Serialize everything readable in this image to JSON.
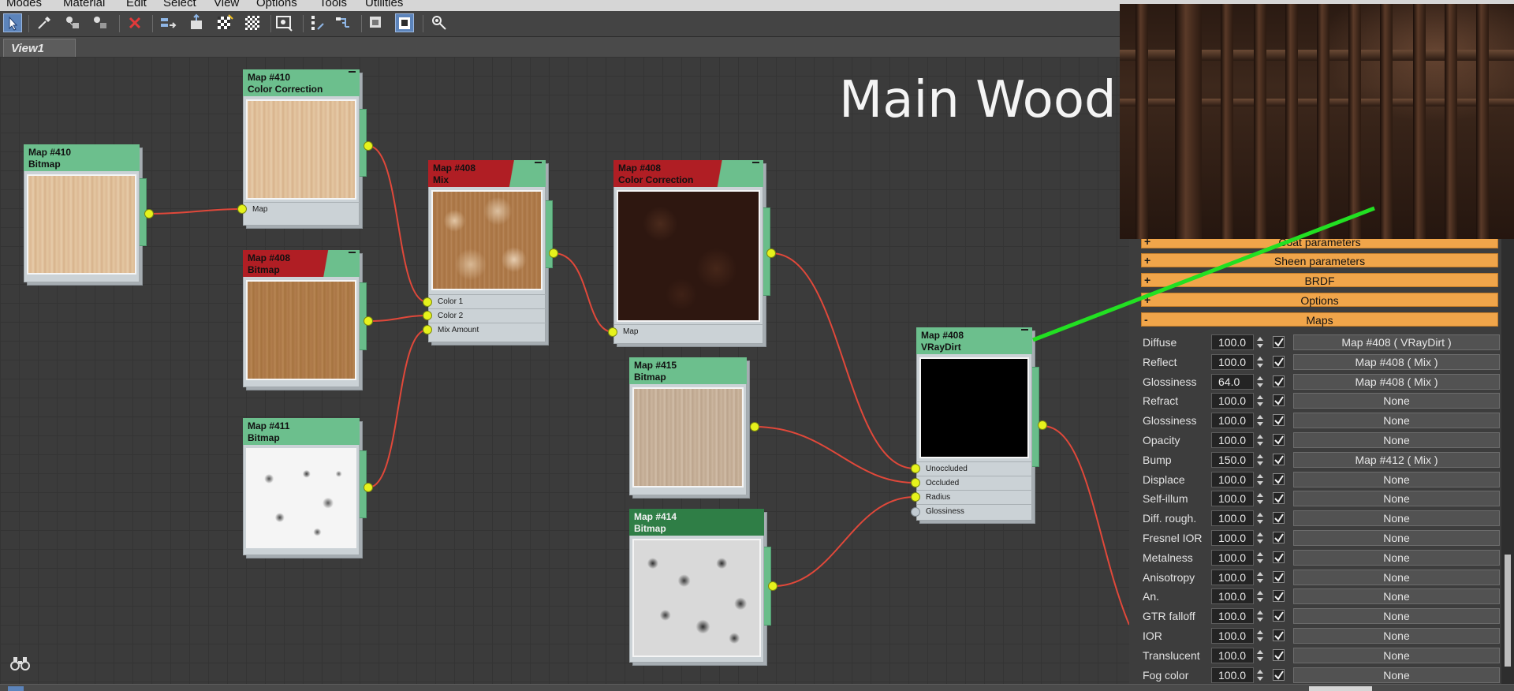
{
  "menu": [
    "Modes",
    "Material",
    "Edit",
    "Select",
    "View",
    "Options",
    "Tools",
    "Utilities"
  ],
  "toolbar": {
    "icons": [
      "select-arrow-icon",
      "eyedropper-icon",
      "put-to-scene-icon",
      "assign-to-selection-icon",
      "delete-icon",
      "move-children-icon",
      "hide-unused-icon",
      "show-map-in-viewport-icon",
      "checker-background-icon",
      "preview-icon",
      "layout-icon",
      "layout-children-icon",
      "show-end-result-icon",
      "parameter-editor-icon",
      "material-map-browser-icon"
    ]
  },
  "view_tab": "View1",
  "canvas": {
    "title": "Main Wood",
    "nodes": [
      {
        "id": "n1",
        "title": "Map #410",
        "subtitle": "Bitmap",
        "header": "green",
        "texture": "wood-light",
        "slots": []
      },
      {
        "id": "n2",
        "title": "Map #410",
        "subtitle": "Color Correction",
        "header": "green",
        "texture": "wood-light",
        "slots": [
          "Map"
        ]
      },
      {
        "id": "n3",
        "title": "Map #408",
        "subtitle": "Bitmap",
        "header": "red",
        "texture": "wood-med",
        "slots": []
      },
      {
        "id": "n4",
        "title": "Map #411",
        "subtitle": "Bitmap",
        "header": "green",
        "texture": "noise-light",
        "slots": []
      },
      {
        "id": "n5",
        "title": "Map #408",
        "subtitle": "Mix",
        "header": "red",
        "texture": "dirt-mix",
        "slots": [
          "Color 1",
          "Color 2",
          "Mix Amount"
        ]
      },
      {
        "id": "n6",
        "title": "Map #408",
        "subtitle": "Color Correction",
        "header": "red",
        "texture": "dark",
        "slots": [
          "Map"
        ]
      },
      {
        "id": "n7",
        "title": "Map #415",
        "subtitle": "Bitmap",
        "header": "green",
        "texture": "wood-grey",
        "slots": []
      },
      {
        "id": "n8",
        "title": "Map #414",
        "subtitle": "Bitmap",
        "header": "dark",
        "texture": "noise-heavy",
        "slots": []
      },
      {
        "id": "n9",
        "title": "Map #408",
        "subtitle": "VRayDirt",
        "header": "green",
        "texture": "black",
        "slots": [
          "Unoccluded",
          "Occluded",
          "Radius",
          "Glossiness"
        ]
      }
    ]
  },
  "panel": {
    "rollouts": [
      {
        "sign": "+",
        "label": "Coat parameters"
      },
      {
        "sign": "+",
        "label": "Sheen parameters"
      },
      {
        "sign": "+",
        "label": "BRDF"
      },
      {
        "sign": "+",
        "label": "Options"
      },
      {
        "sign": "-",
        "label": "Maps"
      }
    ],
    "maps": [
      {
        "name": "Diffuse",
        "value": "100.0",
        "checked": true,
        "map": "Map #408  ( VRayDirt )"
      },
      {
        "name": "Reflect",
        "value": "100.0",
        "checked": true,
        "map": "Map #408  ( Mix )"
      },
      {
        "name": "Glossiness",
        "value": "64.0",
        "checked": true,
        "map": "Map #408  ( Mix )"
      },
      {
        "name": "Refract",
        "value": "100.0",
        "checked": true,
        "map": "None"
      },
      {
        "name": "Glossiness",
        "value": "100.0",
        "checked": true,
        "map": "None"
      },
      {
        "name": "Opacity",
        "value": "100.0",
        "checked": true,
        "map": "None"
      },
      {
        "name": "Bump",
        "value": "150.0",
        "checked": true,
        "map": "Map #412  ( Mix )"
      },
      {
        "name": "Displace",
        "value": "100.0",
        "checked": true,
        "map": "None"
      },
      {
        "name": "Self-illum",
        "value": "100.0",
        "checked": true,
        "map": "None"
      },
      {
        "name": "Diff. rough.",
        "value": "100.0",
        "checked": true,
        "map": "None"
      },
      {
        "name": "Fresnel IOR",
        "value": "100.0",
        "checked": true,
        "map": "None"
      },
      {
        "name": "Metalness",
        "value": "100.0",
        "checked": true,
        "map": "None"
      },
      {
        "name": "Anisotropy",
        "value": "100.0",
        "checked": true,
        "map": "None"
      },
      {
        "name": "An.",
        "value": "100.0",
        "checked": true,
        "map": "None"
      },
      {
        "name": "GTR falloff",
        "value": "100.0",
        "checked": true,
        "map": "None"
      },
      {
        "name": "IOR",
        "value": "100.0",
        "checked": true,
        "map": "None"
      },
      {
        "name": "Translucent",
        "value": "100.0",
        "checked": true,
        "map": "None"
      },
      {
        "name": "Fog color",
        "value": "100.0",
        "checked": true,
        "map": "None"
      }
    ]
  },
  "colors": {
    "node_header": "#6cbf8d",
    "node_header_selected": "#b01e24",
    "port": "#e6f21c",
    "wire": "#e0483a",
    "callout": "#22e022",
    "rollout": "#f0a54a"
  }
}
